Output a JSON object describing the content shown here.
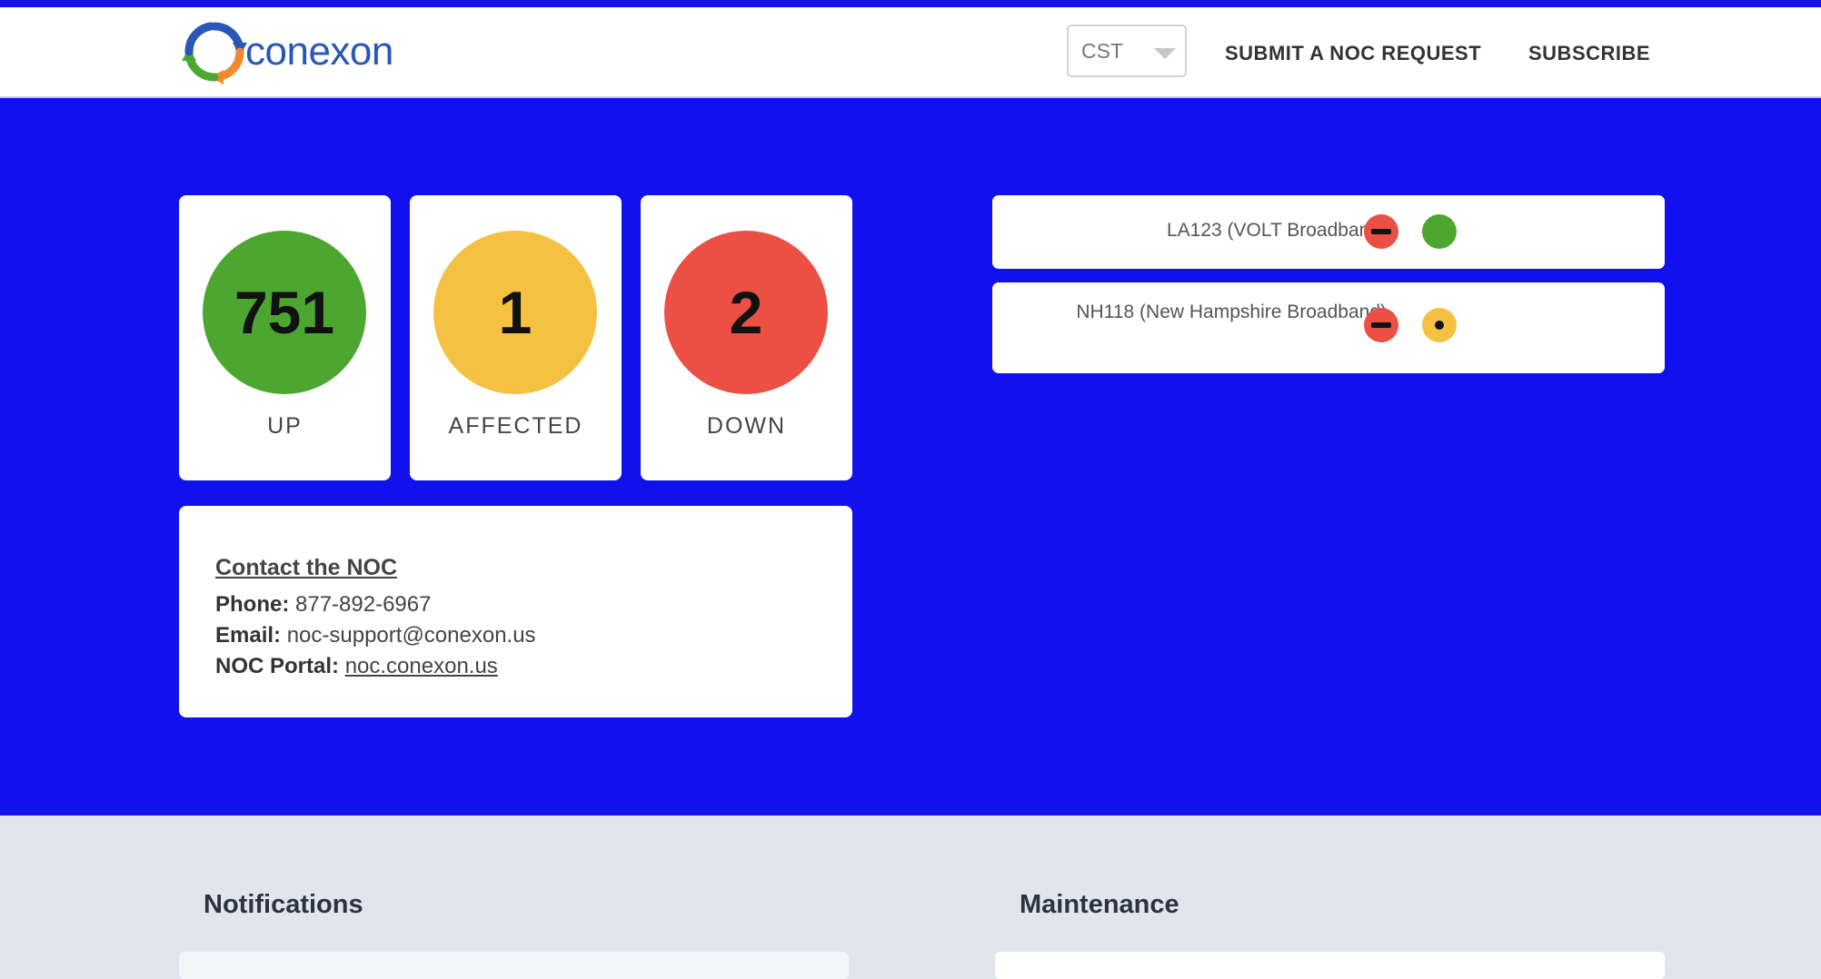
{
  "header": {
    "logo_text": "conexon",
    "timezone": "CST",
    "nav": {
      "submit_request": "SUBMIT A NOC REQUEST",
      "subscribe": "SUBSCRIBE"
    }
  },
  "stats": [
    {
      "value": "751",
      "label": "UP",
      "color": "#4ca630"
    },
    {
      "value": "1",
      "label": "AFFECTED",
      "color": "#f4c142"
    },
    {
      "value": "2",
      "label": "DOWN",
      "color": "#ec5045"
    }
  ],
  "contact": {
    "title": "Contact the NOC",
    "phone_label": "Phone:",
    "phone": "877-892-6967",
    "email_label": "Email:",
    "email": "noc-support@conexon.us",
    "portal_label": "NOC Portal:",
    "portal": "noc.conexon.us"
  },
  "services": [
    {
      "name": "LA123 (VOLT Broadband)",
      "status_colors": [
        "#ec5045",
        "#4ca630"
      ]
    },
    {
      "name": "NH118 (New Hampshire Broadband)",
      "status_colors": [
        "#ec5045",
        "#f4c142"
      ]
    }
  ],
  "sections": {
    "notifications": "Notifications",
    "maintenance": "Maintenance"
  },
  "colors": {
    "hero_bg": "#1111ee",
    "page_bg": "#e1e6ee",
    "logo_blue": "#2a57b5"
  }
}
